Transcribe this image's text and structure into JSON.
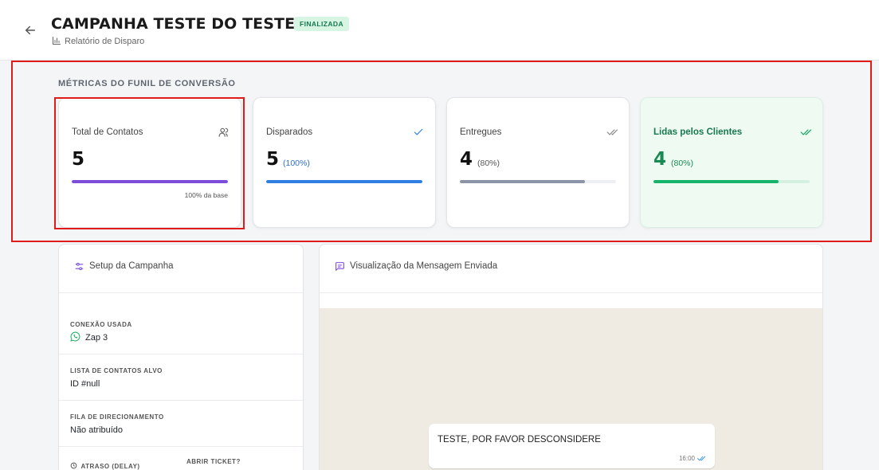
{
  "header": {
    "title": "CAMPANHA TESTE DO TESTE X",
    "status_badge": "FINALIZADA",
    "subtitle": "Relatório de Disparo"
  },
  "funnel": {
    "section_title": "MÉTRICAS DO FUNIL DE CONVERSÃO",
    "cards": [
      {
        "label": "Total de Contatos",
        "value": "5",
        "percent": "",
        "progress": 100,
        "bar_color": "#7c4ddb",
        "footer": "100% da base",
        "icon": "users-icon"
      },
      {
        "label": "Disparados",
        "value": "5",
        "percent": "(100%)",
        "progress": 100,
        "bar_color": "#2f7fe0",
        "footer": "",
        "icon": "check-icon"
      },
      {
        "label": "Entregues",
        "value": "4",
        "percent": "(80%)",
        "progress": 80,
        "bar_color": "#8b95a7",
        "footer": "",
        "icon": "double-check-icon"
      },
      {
        "label": "Lidas pelos Clientes",
        "value": "4",
        "percent": "(80%)",
        "progress": 80,
        "bar_color": "#16b36b",
        "footer": "",
        "icon": "double-check-green-icon"
      }
    ]
  },
  "setup": {
    "title": "Setup da Campanha",
    "fields": [
      {
        "label": "CONEXÃO USADA",
        "value": "Zap 3"
      },
      {
        "label": "LISTA DE CONTATOS ALVO",
        "value": "ID #null"
      },
      {
        "label": "FILA DE DIRECIONAMENTO",
        "value": "Não atribuído"
      }
    ],
    "delay_label": "ATRASO (DELAY)",
    "ticket_label": "ABRIR TICKET?"
  },
  "preview": {
    "title": "Visualização da Mensagem Enviada",
    "message": "TESTE, POR FAVOR DESCONSIDERE",
    "time": "16:00"
  },
  "colors": {
    "accent_purple": "#7c4ddb",
    "accent_blue": "#2f7fe0",
    "accent_green": "#16b36b",
    "highlight_red": "#e01b1b"
  }
}
